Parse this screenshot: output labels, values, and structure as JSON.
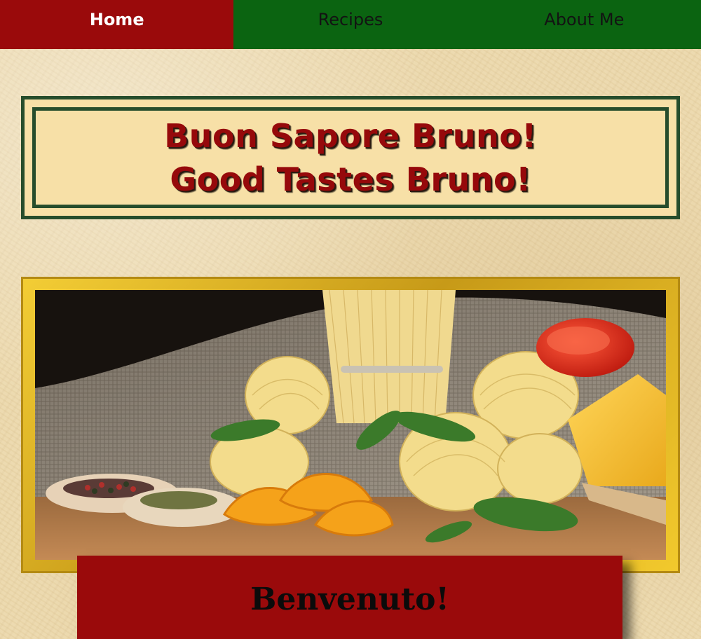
{
  "nav": {
    "items": [
      {
        "label": "Home",
        "active": true
      },
      {
        "label": "Recipes",
        "active": false
      },
      {
        "label": "About Me",
        "active": false
      }
    ]
  },
  "banner": {
    "line1": "Buon Sapore Bruno!",
    "line2": "Good Tastes Bruno!"
  },
  "welcome": {
    "title": "Benvenuto!"
  },
  "colors": {
    "nav_active": "#9a0a0b",
    "nav_inactive": "#0b6411",
    "banner_text": "#96090b",
    "banner_border": "#264d2c",
    "banner_bg": "#f7e0a7",
    "frame_gold": "#e8bf2b",
    "page_bg": "#ecd9ad"
  },
  "icons": {
    "hero": "pasta-still-life-image"
  }
}
